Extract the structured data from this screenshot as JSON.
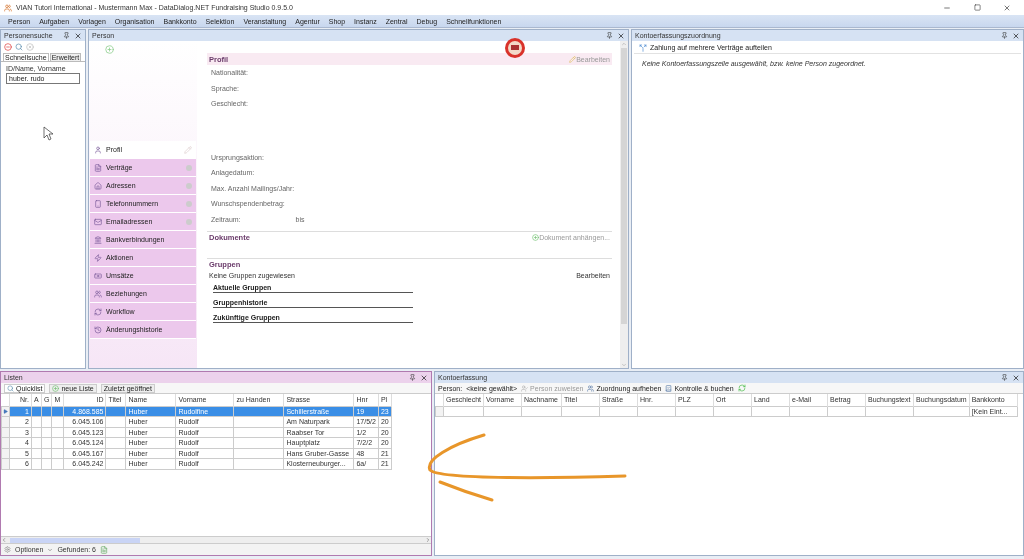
{
  "window": {
    "title": "VIAN Tutori International - Mustermann Max - DataDialog.NET Fundraising Studio 0.9.5.0"
  },
  "menu": [
    "Person",
    "Aufgaben",
    "Vorlagen",
    "Organisation",
    "Bankkonto",
    "Selektion",
    "Veranstaltung",
    "Agentur",
    "Shop",
    "Instanz",
    "Zentral",
    "Debug",
    "Schnellfunktionen"
  ],
  "personensuche": {
    "title": "Personensuche",
    "tabs": [
      {
        "label": "Schnellsuche",
        "selected": true
      },
      {
        "label": "Erweitert",
        "selected": false
      }
    ],
    "field_label": "ID/Name, Vorname",
    "field_value": "huber. rudo"
  },
  "person": {
    "title": "Person",
    "nav": [
      {
        "label": "Profil",
        "selected": true
      },
      {
        "label": "Verträge",
        "selected": false
      },
      {
        "label": "Adressen",
        "selected": false
      },
      {
        "label": "Telefonnummern",
        "selected": false
      },
      {
        "label": "Emailadressen",
        "selected": false
      },
      {
        "label": "Bankverbindungen",
        "selected": false
      },
      {
        "label": "Aktionen",
        "selected": false
      },
      {
        "label": "Umsätze",
        "selected": false
      },
      {
        "label": "Beziehungen",
        "selected": false
      },
      {
        "label": "Workflow",
        "selected": false
      },
      {
        "label": "Änderungshistorie",
        "selected": false
      }
    ],
    "profil": {
      "heading": "Profil",
      "edit": "Bearbeiten",
      "fields_top": [
        "Nationalität:",
        "Sprache:",
        "Geschlecht:"
      ],
      "fields_bottom": [
        "Ursprungsaktion:",
        "Anlagedatum:",
        "Max. Anzahl Mailings/Jahr:",
        "Wunschspendenbetrag:"
      ],
      "range_label": "Zeitraum:",
      "range_sep": "bis"
    },
    "dokumente": {
      "heading": "Dokumente",
      "action": "Dokument anhängen..."
    },
    "gruppen": {
      "heading": "Gruppen",
      "note": "Keine Gruppen zugewiesen",
      "edit": "Bearbeiten",
      "sections": [
        "Aktuelle Gruppen",
        "Gruppenhistorie",
        "Zukünftige Gruppen"
      ]
    }
  },
  "zuordnung": {
    "title": "Kontoerfassungszuordnung",
    "action": "Zahlung auf mehrere Verträge aufteilen",
    "message": "Keine Kontoerfassungszeile ausgewählt, bzw. keine Person zugeordnet."
  },
  "listen": {
    "title": "Listen",
    "tabs": [
      {
        "label": "Quicklist",
        "selected": true
      },
      {
        "label": "neue Liste",
        "selected": false
      },
      {
        "label": "Zuletzt geöffnet",
        "selected": false
      }
    ],
    "columns": [
      "Nr.",
      "A",
      "G",
      "M",
      "ID",
      "Titel",
      "Name",
      "Vorname",
      "zu Handen",
      "Strasse",
      "Hnr",
      "Pl"
    ],
    "rows": [
      {
        "selected": true,
        "cells": [
          "1",
          "",
          "",
          "",
          "4.868.585",
          "",
          "Huber",
          "Rudolfine",
          "",
          "Schillerstraße",
          "19",
          "23"
        ]
      },
      {
        "selected": false,
        "cells": [
          "2",
          "",
          "",
          "",
          "6.045.106",
          "",
          "Huber",
          "Rudolf",
          "",
          "Am Naturpark",
          "17/5/2",
          "20"
        ]
      },
      {
        "selected": false,
        "cells": [
          "3",
          "",
          "",
          "",
          "6.045.123",
          "",
          "Huber",
          "Rudolf",
          "",
          "Raabser Tor",
          "1/2",
          "20"
        ]
      },
      {
        "selected": false,
        "cells": [
          "4",
          "",
          "",
          "",
          "6.045.124",
          "",
          "Huber",
          "Rudolf",
          "",
          "Hauptplatz",
          "7/2/2",
          "20"
        ]
      },
      {
        "selected": false,
        "cells": [
          "5",
          "",
          "",
          "",
          "6.045.167",
          "",
          "Huber",
          "Rudolf",
          "",
          "Hans Gruber-Gasse",
          "48",
          "21"
        ]
      },
      {
        "selected": false,
        "cells": [
          "6",
          "",
          "",
          "",
          "6.045.242",
          "",
          "Huber",
          "Rudolf",
          "",
          "Klosterneuburger...",
          "6a/",
          "21"
        ]
      }
    ],
    "options": "Optionen",
    "found": "Gefunden: 6"
  },
  "kontoerfassung": {
    "title": "Kontoerfassung",
    "person_label": "Person:",
    "person_value": "<keine gewählt>",
    "buttons": [
      {
        "label": "Person zuweisen",
        "disabled": true
      },
      {
        "label": "Zuordnung aufheben",
        "disabled": false
      },
      {
        "label": "Kontrolle & buchen",
        "disabled": false
      }
    ],
    "columns": [
      "Geschlecht",
      "Vorname",
      "Nachname",
      "Titel",
      "Straße",
      "Hnr.",
      "PLZ",
      "Ort",
      "Land",
      "e-Mail",
      "Betrag",
      "Buchungstext",
      "Buchungsdatum",
      "Bankkonto"
    ],
    "rows": [
      [
        "",
        "",
        "",
        "",
        "",
        "",
        "",
        "",
        "",
        "",
        "",
        "",
        "",
        "[Kein Eint..."
      ]
    ]
  }
}
